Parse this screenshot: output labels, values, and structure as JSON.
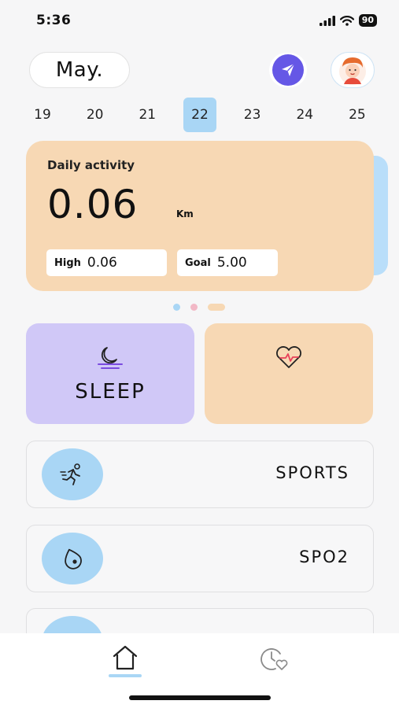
{
  "status_bar": {
    "time": "5:36",
    "battery": "90"
  },
  "header": {
    "month": "May."
  },
  "dates": [
    {
      "label": "19",
      "active": false
    },
    {
      "label": "20",
      "active": false
    },
    {
      "label": "21",
      "active": false
    },
    {
      "label": "22",
      "active": true
    },
    {
      "label": "23",
      "active": false
    },
    {
      "label": "24",
      "active": false
    },
    {
      "label": "25",
      "active": false
    }
  ],
  "activity": {
    "title": "Daily activity",
    "value": "0.06",
    "unit": "Km",
    "high_label": "High",
    "high_value": "0.06",
    "goal_label": "Goal",
    "goal_value": "5.00"
  },
  "tiles": {
    "sleep_label": "SLEEP"
  },
  "rows": [
    {
      "label": "SPORTS",
      "icon": "running-icon"
    },
    {
      "label": "SPO2",
      "icon": "spo2-icon"
    }
  ],
  "colors": {
    "activity_card": "#f7d8b4",
    "sleep_tile": "#d0c8f7",
    "accent_blue": "#a9d6f5",
    "send_button": "#6557e6",
    "pagination_dots": [
      "#a9d6f5",
      "#f2b8c6",
      "#f7d8b4"
    ]
  }
}
